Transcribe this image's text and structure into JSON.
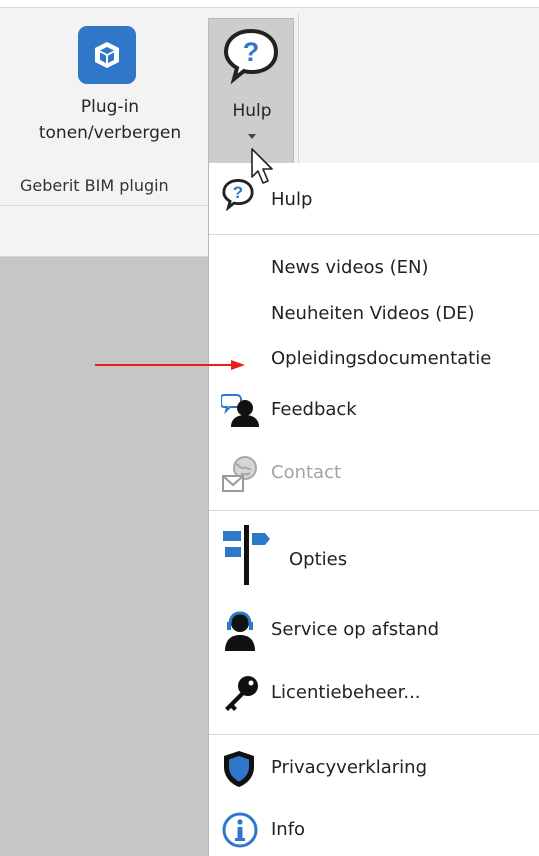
{
  "ribbon": {
    "plugin_button": {
      "label_line1": "Plug-in",
      "label_line2": "tonen/verbergen",
      "icon": "cube-icon"
    },
    "hulp_button": {
      "label": "Hulp",
      "icon": "help-bubble-icon"
    },
    "group_label": "Geberit BIM plugin"
  },
  "menu": {
    "items": [
      {
        "label": "Hulp",
        "icon": "help-bubble-icon"
      },
      {
        "label": "News videos (EN)"
      },
      {
        "label": "Neuheiten Videos (DE)"
      },
      {
        "label": "Opleidingsdocumentatie"
      },
      {
        "label": "Feedback",
        "icon": "feedback-user-icon"
      },
      {
        "label": "Contact",
        "icon": "contact-globe-icon",
        "disabled": true
      },
      {
        "label": "Opties",
        "icon": "signpost-icon"
      },
      {
        "label": "Service op afstand",
        "icon": "remote-service-icon"
      },
      {
        "label": "Licentiebeheer...",
        "icon": "key-icon"
      },
      {
        "label": "Privacyverklaring",
        "icon": "shield-icon"
      },
      {
        "label": "Info",
        "icon": "info-icon"
      }
    ]
  },
  "annotation": {
    "arrow_color": "#e8201c"
  },
  "colors": {
    "accent_blue": "#2f77c9",
    "ribbon_bg": "#f3f3f3",
    "workspace_bg": "#c6c6c6"
  }
}
